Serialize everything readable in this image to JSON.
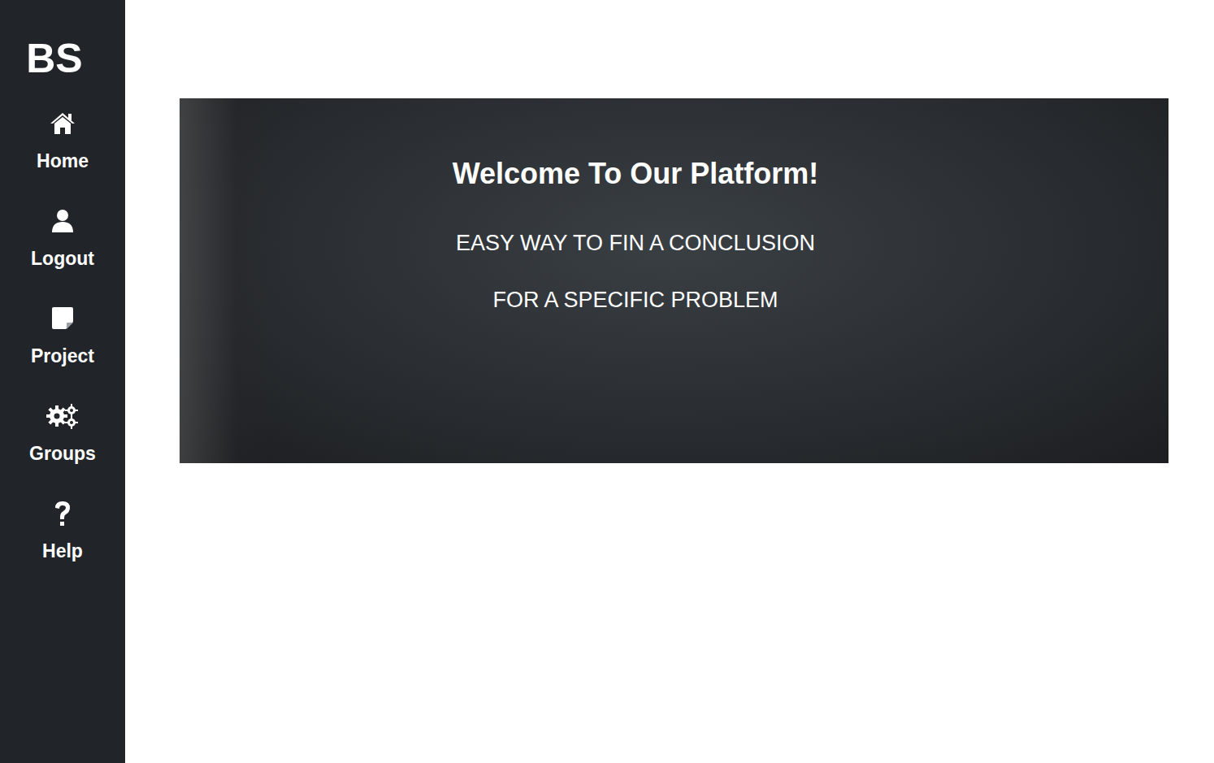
{
  "sidebar": {
    "logo": "BS",
    "items": [
      {
        "label": "Home",
        "icon": "home"
      },
      {
        "label": "Logout",
        "icon": "user"
      },
      {
        "label": "Project",
        "icon": "note"
      },
      {
        "label": "Groups",
        "icon": "gears"
      },
      {
        "label": "Help",
        "icon": "help"
      }
    ]
  },
  "banner": {
    "title": "Welcome To Our Platform!",
    "lines": [
      "EASY WAY TO FIN A CONCLUSION",
      "FOR A SPECIFIC PROBLEM"
    ]
  }
}
